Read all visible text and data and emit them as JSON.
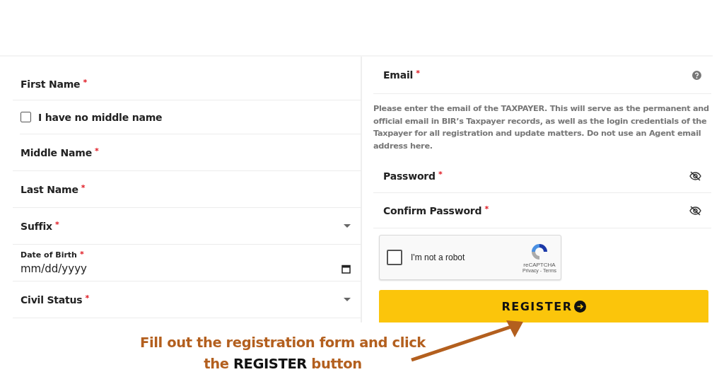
{
  "left_fields": [
    {
      "kind": "text",
      "label": "First Name",
      "mark": "*"
    },
    {
      "kind": "checkbox",
      "label": "I have no middle name",
      "checked": false
    },
    {
      "kind": "text",
      "label": "Middle Name",
      "mark": "*"
    },
    {
      "kind": "text",
      "label": "Last Name",
      "mark": "*"
    },
    {
      "kind": "select",
      "label": "Suffix",
      "mark": "*"
    },
    {
      "kind": "date",
      "label": "Date of Birth",
      "mark": "*",
      "placeholder": "mm/dd/yyyy"
    },
    {
      "kind": "select",
      "label": "Civil Status",
      "mark": "*"
    }
  ],
  "email": {
    "label": "Email",
    "mark": "*",
    "note": "Please enter the email of the TAXPAYER. This will serve as the permanent and official email in BIR’s Taxpayer records, as well as the login credentials of the Taxpayer for all registration and update matters. Do not use an Agent email address here."
  },
  "password_fields": [
    {
      "label": "Password",
      "mark": "*"
    },
    {
      "label": "Confirm Password",
      "mark": "*"
    }
  ],
  "captcha": {
    "label": "I'm not a robot",
    "checked": false,
    "brand": "reCAPTCHA",
    "links": "Privacy - Terms"
  },
  "register_button": "REGISTER",
  "annotation": "Fill out the registration form and click the **REGISTER** button"
}
